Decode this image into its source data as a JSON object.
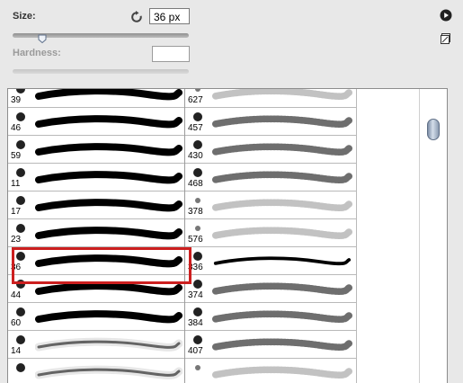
{
  "controls": {
    "size_label": "Size:",
    "size_value": "36 px",
    "size_slider_percent": 17,
    "hardness_label": "Hardness:",
    "hardness_value": ""
  },
  "brushes": {
    "left": [
      {
        "num": "39",
        "kind": "solid"
      },
      {
        "num": "46",
        "kind": "solid"
      },
      {
        "num": "59",
        "kind": "solid"
      },
      {
        "num": "11",
        "kind": "solid"
      },
      {
        "num": "17",
        "kind": "solid"
      },
      {
        "num": "23",
        "kind": "solid"
      },
      {
        "num": "36",
        "kind": "solid"
      },
      {
        "num": "44",
        "kind": "solid"
      },
      {
        "num": "60",
        "kind": "solid"
      },
      {
        "num": "14",
        "kind": "soft"
      },
      {
        "num": "",
        "kind": "soft"
      }
    ],
    "right": [
      {
        "num": "627",
        "kind": "light"
      },
      {
        "num": "457",
        "kind": "dots"
      },
      {
        "num": "430",
        "kind": "dots"
      },
      {
        "num": "468",
        "kind": "dots"
      },
      {
        "num": "378",
        "kind": "light"
      },
      {
        "num": "576",
        "kind": "light"
      },
      {
        "num": "336",
        "kind": "thin"
      },
      {
        "num": "374",
        "kind": "dots"
      },
      {
        "num": "384",
        "kind": "dots"
      },
      {
        "num": "407",
        "kind": "dots"
      },
      {
        "num": "",
        "kind": "light"
      }
    ],
    "selected_brush": "36"
  }
}
